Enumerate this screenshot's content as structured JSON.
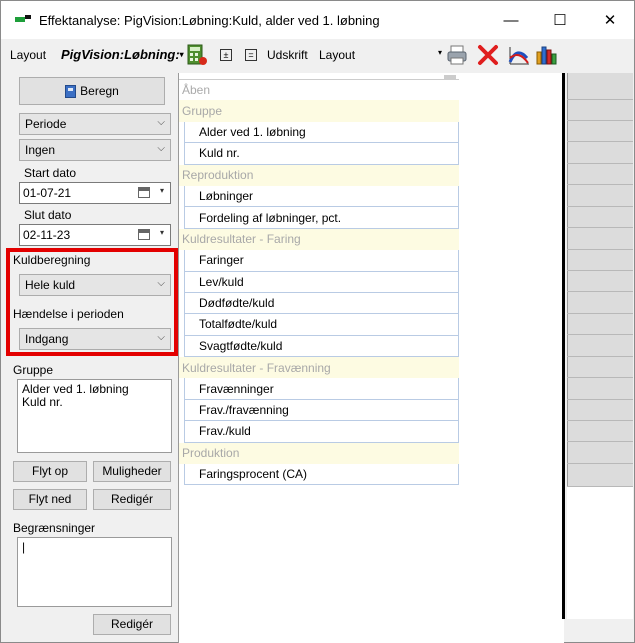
{
  "window": {
    "title": "Effektanalyse: PigVision:Løbning:Kuld, alder ved 1. løbning",
    "minimize": "—",
    "maximize": "☐",
    "close": "✕"
  },
  "toolbar": {
    "layout_label": "Layout",
    "layout_name": "PigVision:Løbning:",
    "layout_name_arrow": "▾",
    "plusminus": "±",
    "equals": "=",
    "udskrift_label": "Udskrift",
    "layout_select_value": "Layout",
    "layout_select_arrow": "▾"
  },
  "left": {
    "beregn_label": "Beregn",
    "periode_select": "Periode",
    "ingen_select": "Ingen",
    "start_dato_label": "Start dato",
    "start_dato_value": "01-07-21",
    "slut_dato_label": "Slut dato",
    "slut_dato_value": "02-11-23",
    "kuldberegning_label": "Kuldberegning",
    "kuldberegning_value": "Hele kuld",
    "haendelse_label": "Hændelse i perioden",
    "haendelse_value": "Indgang",
    "gruppe_label": "Gruppe",
    "gruppe_items": [
      "Alder ved 1. løbning",
      "Kuld nr."
    ],
    "flyt_op": "Flyt op",
    "muligheder": "Muligheder",
    "flyt_ned": "Flyt ned",
    "rediger_1": "Redigér",
    "begraensninger_label": "Begrænsninger",
    "begraensninger_value": "|",
    "rediger_2": "Redigér",
    "chevron": "⌵"
  },
  "tree": {
    "top": "Åben",
    "groups": [
      {
        "name": "Gruppe",
        "items": [
          "Alder ved 1. løbning",
          "Kuld nr."
        ]
      },
      {
        "name": "Reproduktion",
        "items": [
          "Løbninger",
          "Fordeling af løbninger, pct."
        ]
      },
      {
        "name": "Kuldresultater - Faring",
        "items": [
          "Faringer",
          "Lev/kuld",
          "Dødfødte/kuld",
          "Totalfødte/kuld",
          "Svagtfødte/kuld"
        ]
      },
      {
        "name": "Kuldresultater - Fravænning",
        "items": [
          "Fravænninger",
          "Frav./fravænning",
          "Frav./kuld"
        ]
      },
      {
        "name": "Produktion",
        "items": [
          "Faringsprocent (CA)"
        ]
      }
    ]
  },
  "icons": {
    "app": "pigvision-app-icon",
    "calc": "calculator-icon",
    "print": "printer-icon",
    "delete": "red-x-delete-icon",
    "curve": "curve-chart-icon",
    "bars": "bar-chart-icon"
  },
  "colors": {
    "highlight": "#e30000",
    "group_bg": "#fdfbe2",
    "item_border": "#b9cbe4"
  }
}
